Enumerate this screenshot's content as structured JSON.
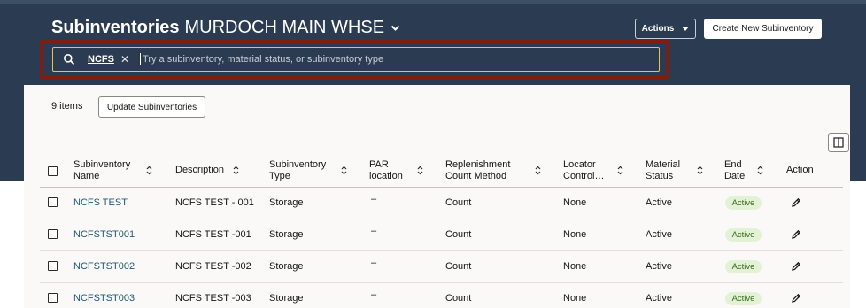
{
  "header": {
    "title_bold": "Subinventories",
    "title_org": "MURDOCH MAIN WHSE",
    "actions_label": "Actions",
    "create_label": "Create New Subinventory"
  },
  "search": {
    "chip": "NCFS",
    "placeholder": "Try a subinventory, material status, or subinventory type"
  },
  "toolbar": {
    "items_count": "9 items",
    "update_label": "Update Subinventories"
  },
  "columns": [
    {
      "l1": "Subinventory",
      "l2": "Name"
    },
    {
      "l1": "Description",
      "l2": ""
    },
    {
      "l1": "Subinventory",
      "l2": "Type"
    },
    {
      "l1": "PAR",
      "l2": "location"
    },
    {
      "l1": "Replenishment",
      "l2": "Count Method"
    },
    {
      "l1": "Locator",
      "l2": "Control…"
    },
    {
      "l1": "Material",
      "l2": "Status"
    },
    {
      "l1": "End",
      "l2": "Date"
    },
    {
      "l1": "Action",
      "l2": ""
    }
  ],
  "rows": [
    {
      "name": "NCFS TEST",
      "description": "NCFS TEST - 001",
      "type": "Storage",
      "par": "–",
      "count_method": "Count",
      "locator": "None",
      "material_status": "Active",
      "end_date": "Active"
    },
    {
      "name": "NCFSTST001",
      "description": "NCFS TEST -001",
      "type": "Storage",
      "par": "–",
      "count_method": "Count",
      "locator": "None",
      "material_status": "Active",
      "end_date": "Active"
    },
    {
      "name": "NCFSTST002",
      "description": "NCFS TEST -002",
      "type": "Storage",
      "par": "–",
      "count_method": "Count",
      "locator": "None",
      "material_status": "Active",
      "end_date": "Active"
    },
    {
      "name": "NCFSTST003",
      "description": "NCFS TEST -003",
      "type": "Storage",
      "par": "–",
      "count_method": "Count",
      "locator": "None",
      "material_status": "Active",
      "end_date": "Active"
    }
  ],
  "colors": {
    "header_bg": "#2b3c52",
    "highlight_border": "#7f1d11",
    "search_border": "#e7c44f",
    "link": "#1f5a7a",
    "badge_bg": "#e3f2d6",
    "badge_text": "#3a6b1d"
  },
  "icons": {
    "title_menu": "chevron-down-icon",
    "search": "search-icon",
    "chip_remove": "close-icon",
    "column_layout": "columns-icon",
    "sort": "sort-icon",
    "row_edit": "pencil-icon"
  }
}
